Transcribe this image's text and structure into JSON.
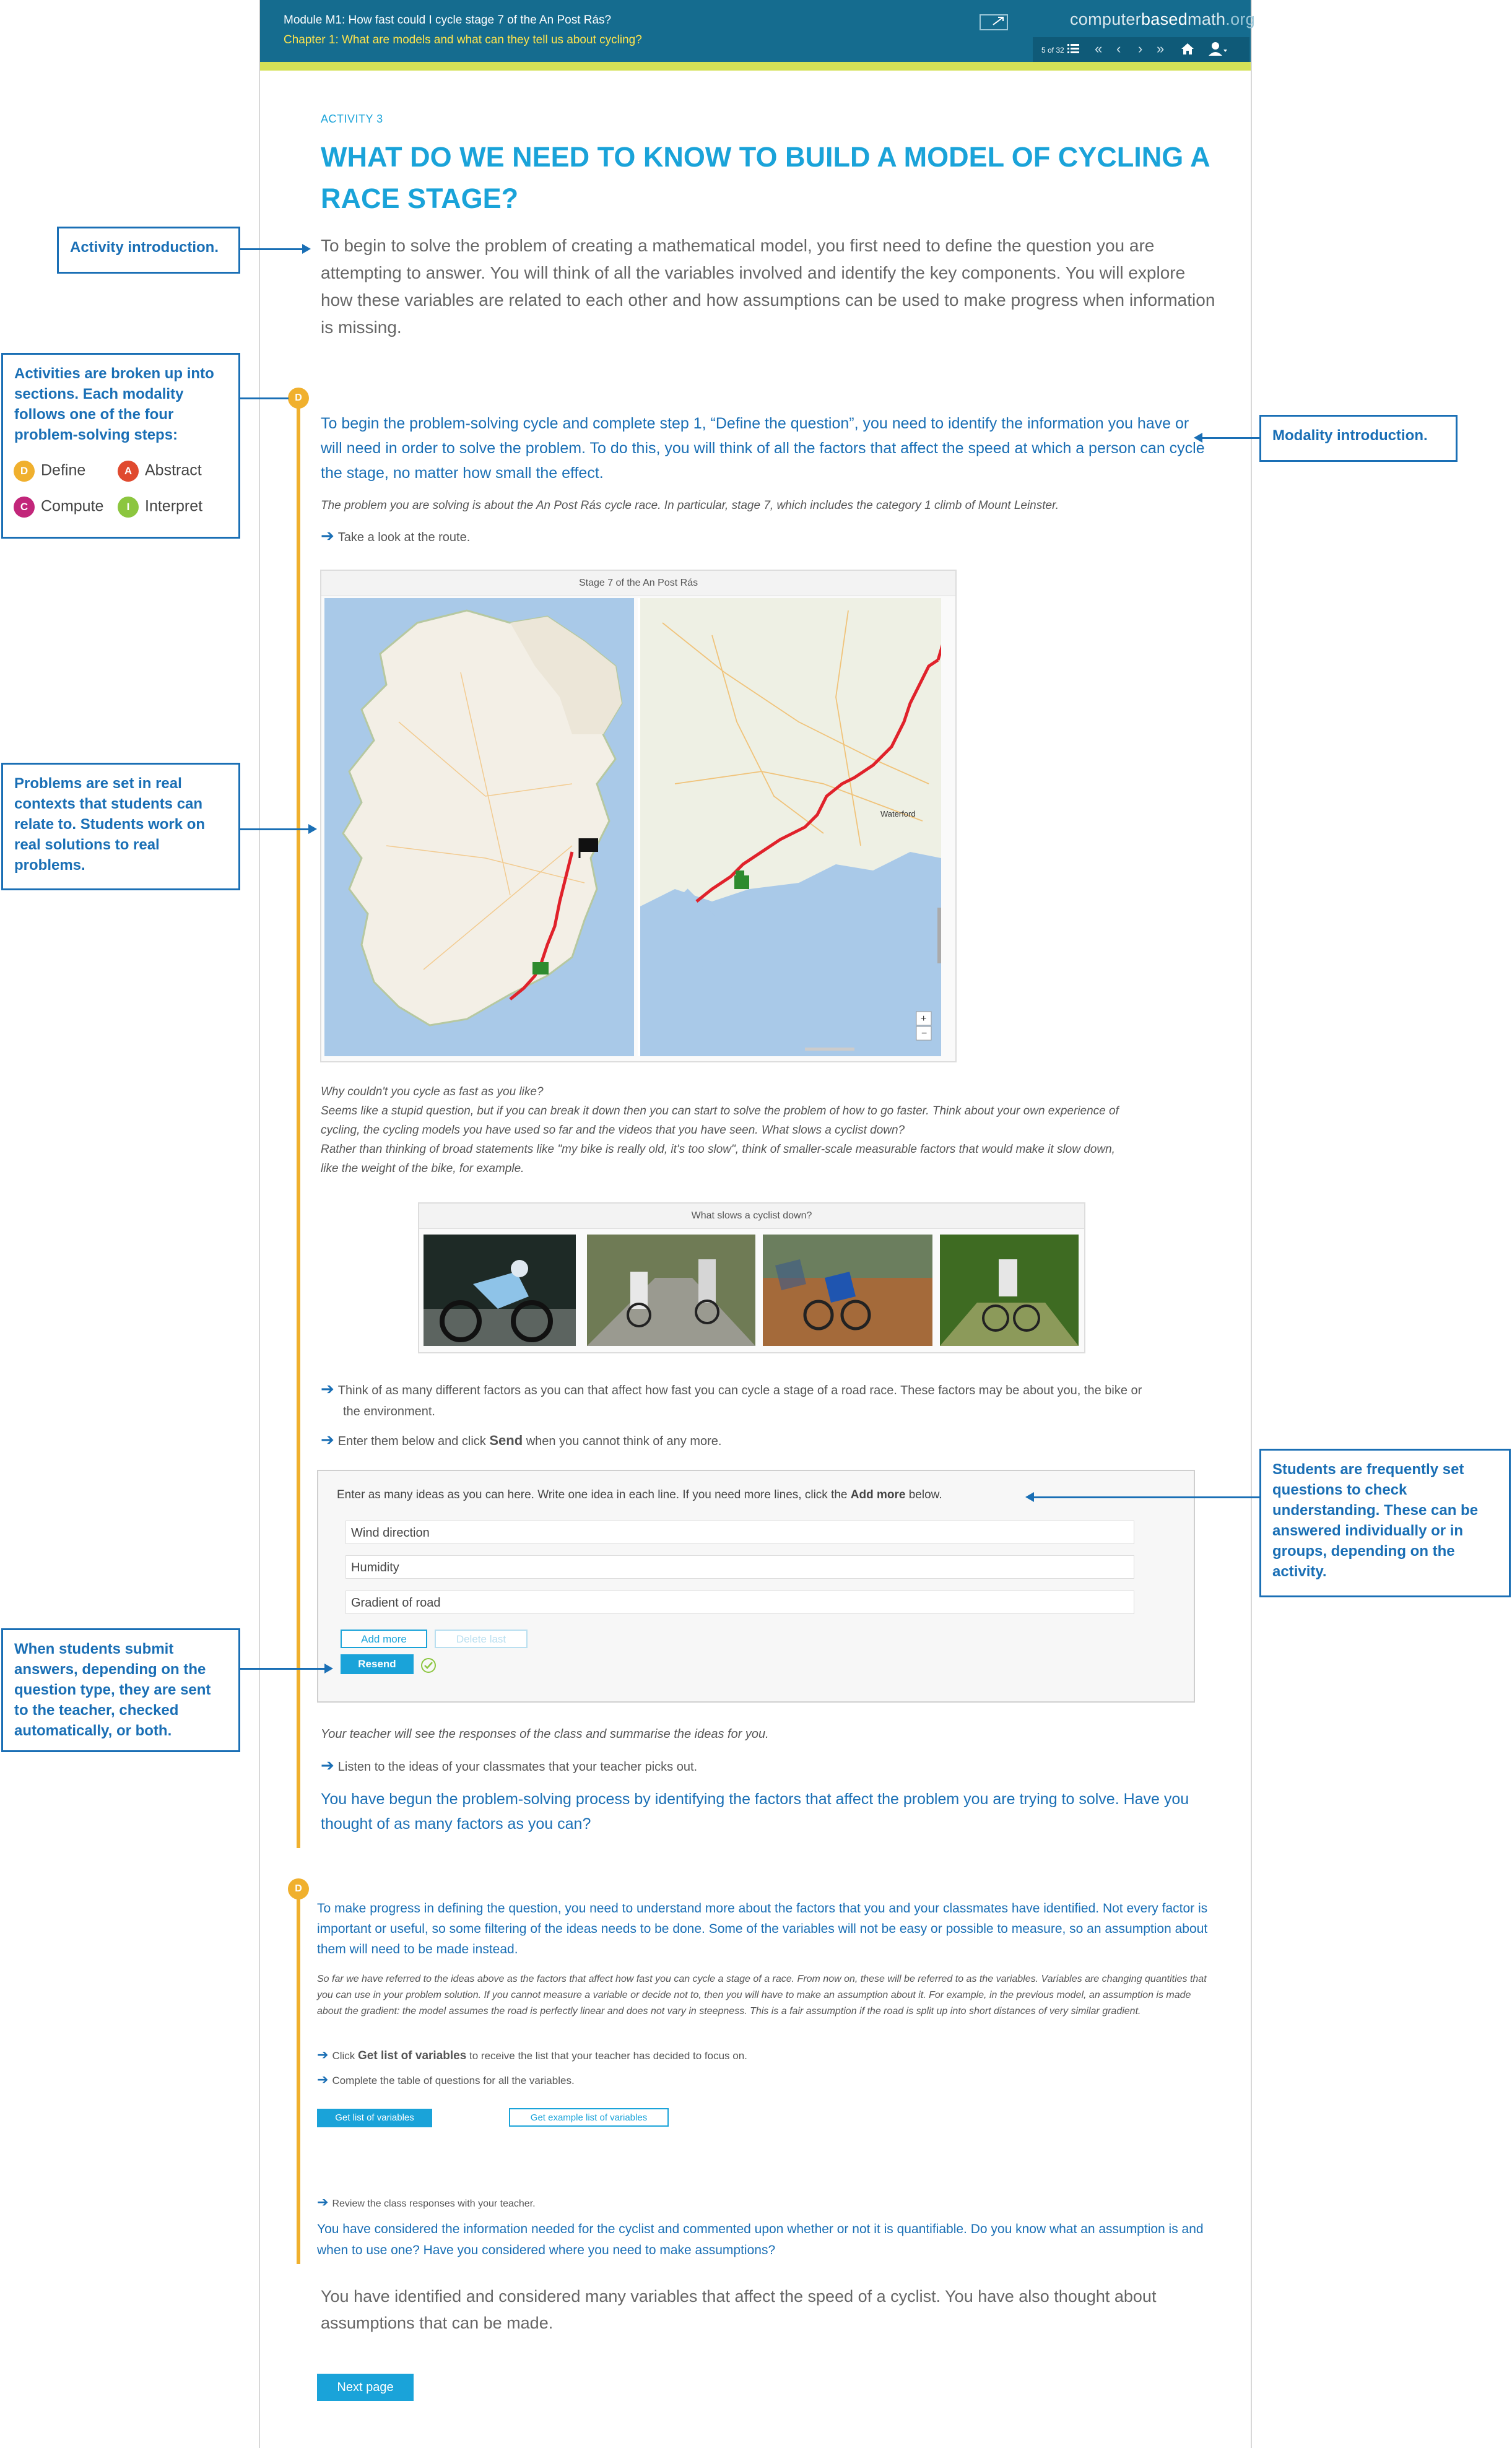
{
  "header": {
    "module_title": "Module M1: How fast could I cycle stage 7 of the An Post Rás?",
    "chapter_title": "Chapter 1: What are models and what can they tell us about cycling?",
    "brand_part1": "computer",
    "brand_part2": "based",
    "brand_part3": "math",
    "brand_part4": ".org",
    "page_counter": "5 of 32"
  },
  "activity": {
    "label": "ACTIVITY 3",
    "title": "WHAT DO WE NEED TO KNOW TO BUILD A MODEL OF CYCLING A RACE STAGE?",
    "intro": "To begin to solve the problem of creating a mathematical model, you first need to define the question you are attempting to answer. You will think of all the variables involved and identify the key components. You will explore how these variables are related to each other and how assumptions can be used to make progress when information is missing."
  },
  "section1": {
    "badge": "D",
    "modality_intro": "To begin the problem-solving cycle and complete step 1, “Define the question”, you need to identify the information you have or will need in order to solve the problem. To do this, you will think of all the factors that affect the speed at which a person can cycle the stage, no matter how small the effect.",
    "problem_note": "The problem you are solving is about the An Post Rás cycle race. In particular, stage 7, which includes the category 1 climb of Mount Leinster.",
    "step_route": "Take a look at the route.",
    "map_title": "Stage 7 of the An Post Rás",
    "map_town": "Waterford",
    "why_lines": [
      "Why couldn't you cycle as fast as you like?",
      "Seems like a stupid question, but if you can break it down then you can start to solve the problem of how to go faster. Think about your own experience of",
      "cycling, the cycling models you have used so far and the videos that you have seen. What slows a cyclist down?",
      "Rather than thinking of broad statements like \"my bike is really old, it's too slow\", think of smaller-scale measurable factors that would make it slow down,",
      "like the weight of the bike, for example."
    ],
    "photos_title": "What slows a cyclist down?",
    "step_think_1": "Think of as many different factors as you can that affect how fast you can cycle a stage of a road race. These factors may be about you, the bike or",
    "step_think_2": "the environment.",
    "step_enter_pre": "Enter them below and click ",
    "step_enter_bold": "Send",
    "step_enter_post": " when you cannot think of any more.",
    "quiz": {
      "prompt_pre": "Enter as many ideas as you can here. Write one idea in each line. If you need more lines, click the ",
      "prompt_bold": "Add more",
      "prompt_post": " below.",
      "answers": [
        "Wind direction",
        "Humidity",
        "Gradient of road"
      ],
      "add_more": "Add more",
      "delete_last": "Delete last",
      "resend": "Resend"
    },
    "teacher_note": "Your teacher will see the responses of the class and summarise the ideas for you.",
    "step_listen": "Listen to the ideas of your classmates that your teacher picks out.",
    "summary": "You have begun the problem-solving process by identifying the factors that affect the problem you are trying to solve. Have you thought of as many factors as you can?"
  },
  "section2": {
    "badge": "D",
    "intro": "To make progress in defining the question, you need to understand more about the factors that you and your classmates have identified. Not every factor is important or useful, so some filtering of the ideas needs to be done. Some of the variables will not be easy or possible to measure, so an assumption about them will need to be made instead.",
    "note": "So far we have referred to the ideas above as the factors that affect how fast you can cycle a stage of a race. From now on, these will be referred to as the variables. Variables are changing quantities that you can use in your problem solution. If you cannot measure a variable or decide not to, then you will have to make an assumption about it. For example, in the previous model, an assumption is made about the gradient: the model assumes the road is perfectly linear and does not vary in steepness. This is a fair assumption if the road is split up into short distances of very similar gradient.",
    "step_click_pre": "Click ",
    "step_click_bold": "Get list of variables",
    "step_click_post": " to receive the list that your teacher has decided to focus on.",
    "step_complete": "Complete the table of questions for all the variables.",
    "btn_get_list": "Get list of variables",
    "btn_get_example": "Get example list of variables",
    "step_review": "Review the class responses with your teacher.",
    "summary": "You have considered the information needed for the cyclist and commented upon whether or not it is quantifiable. Do you know what an assumption is and when to use one? Have you considered where you need to make assumptions?"
  },
  "conclusion": "You have identified and considered many variables that affect the speed of a cyclist. You have also thought about assumptions that can be made.",
  "next_page": "Next page",
  "callouts": {
    "activity_intro": "Activity introduction.",
    "sections": "Activities are broken up into sections. Each modality follows one of the four problem-solving steps:",
    "legend": [
      {
        "letter": "D",
        "label": "Define",
        "color": "#f0b02e"
      },
      {
        "letter": "A",
        "label": "Abstract",
        "color": "#e04a2f"
      },
      {
        "letter": "C",
        "label": "Compute",
        "color": "#c2267a"
      },
      {
        "letter": "I",
        "label": "Interpret",
        "color": "#8cc63f"
      }
    ],
    "contexts": "Problems are set in real contexts that students can relate to. Students work on real solutions to real problems.",
    "modality_intro": "Modality introduction.",
    "questions": "Students are frequently set questions to check understanding. These can be answered individually or in groups, depending on the activity.",
    "submit": "When students submit answers, depending on the question type, they are sent to the teacher, checked automatically, or both."
  },
  "colors": {
    "header_bg": "#156c8f",
    "accent": "#1aa3d9",
    "define": "#f0b02e",
    "callout": "#1a6fb5",
    "route": "#e0222b"
  }
}
